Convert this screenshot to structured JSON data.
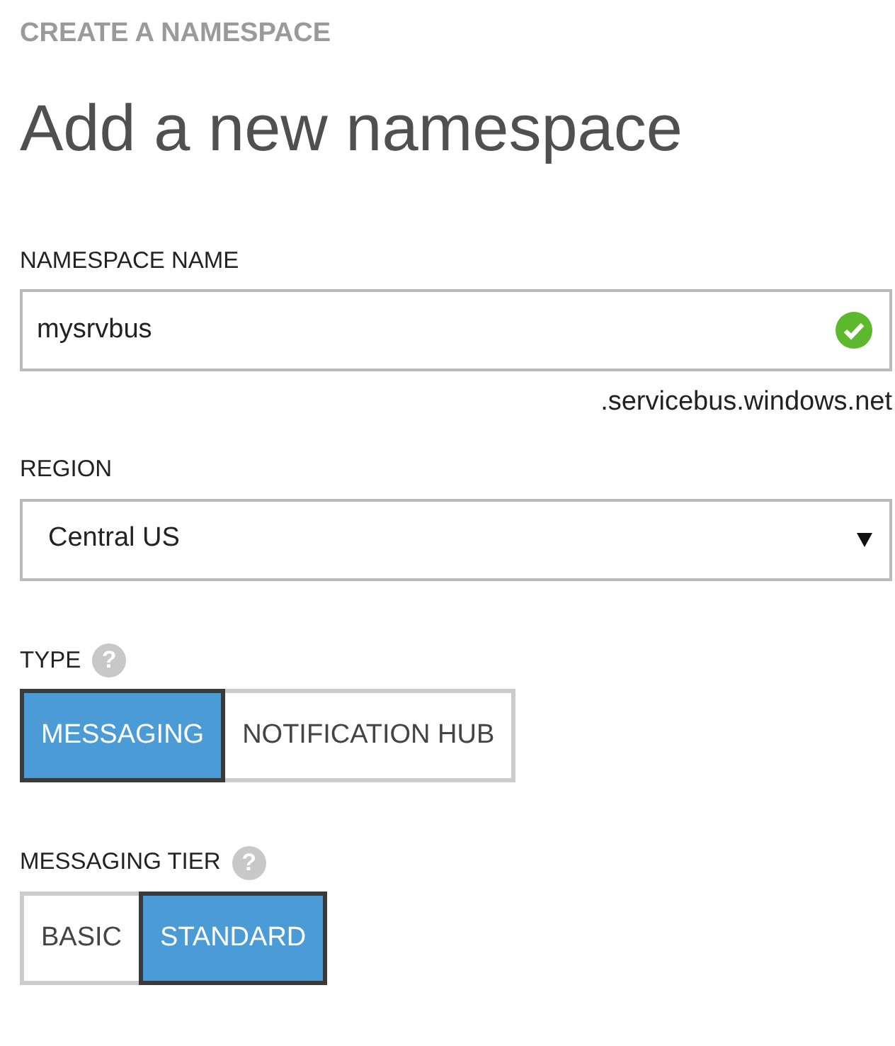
{
  "section_label": "CREATE A NAMESPACE",
  "title": "Add a new namespace",
  "fields": [
    {
      "kind": "text",
      "label": "NAMESPACE NAME",
      "value": "mysrvbus",
      "valid": true,
      "suffix": ".servicebus.windows.net"
    },
    {
      "kind": "select",
      "label": "REGION",
      "value": "Central US"
    },
    {
      "kind": "segmented",
      "label": "TYPE",
      "help": "?",
      "options": [
        {
          "label": "MESSAGING",
          "selected": true
        },
        {
          "label": "NOTIFICATION HUB",
          "selected": false
        }
      ]
    },
    {
      "kind": "segmented",
      "label": "MESSAGING TIER",
      "help": "?",
      "options": [
        {
          "label": "BASIC",
          "selected": false
        },
        {
          "label": "STANDARD",
          "selected": true
        }
      ]
    }
  ]
}
